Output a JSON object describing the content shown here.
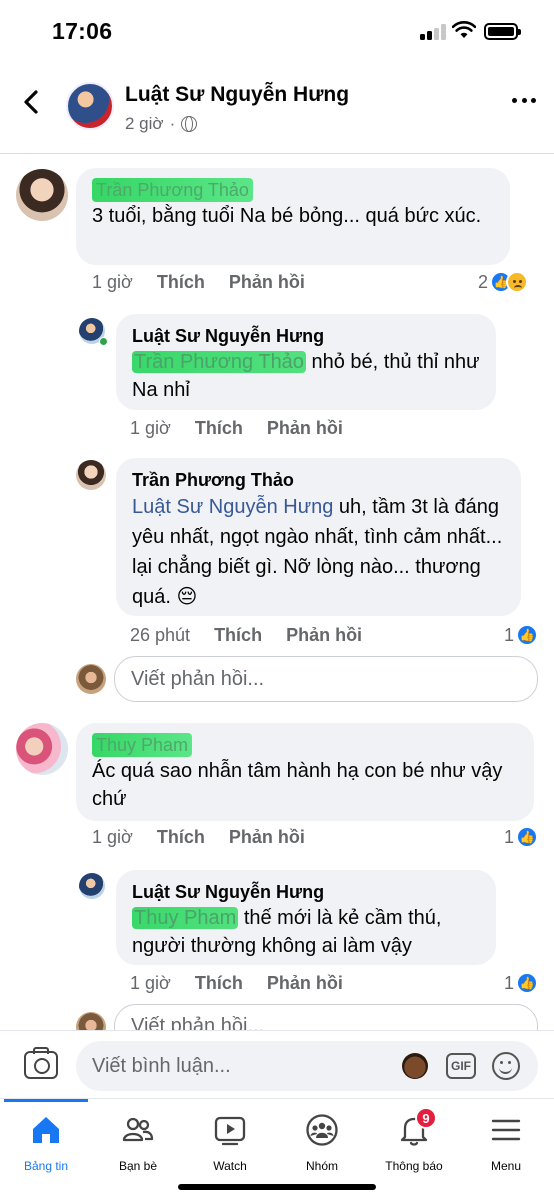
{
  "status_bar": {
    "time": "17:06"
  },
  "header": {
    "name": "Luật Sư Nguyễn Hưng",
    "time": "2 giờ",
    "separator": "·"
  },
  "comments": [
    {
      "author": "Trần Phương Thảo",
      "text": "3 tuổi, bằng tuổi Na bé bỏng... quá bức xúc.",
      "time": "1 giờ",
      "like": "Thích",
      "reply": "Phản hồi",
      "reaction_count": "2",
      "replies": [
        {
          "author": "Luật Sư Nguyễn Hưng",
          "mention": "Trần Phương Thảo",
          "text": " nhỏ bé, thủ thỉ như Na nhỉ",
          "time": "1 giờ",
          "like": "Thích",
          "reply": "Phản hồi"
        },
        {
          "author": "Trần Phương Thảo",
          "mention": "Luật Sư Nguyễn Hưng",
          "text": "  uh, tầm 3t là đáng yêu nhất, ngọt ngào nhất, tình cảm nhất... lại chẳng biết gì. Nỡ lòng nào... thương quá. 😔",
          "time": "26 phút",
          "like": "Thích",
          "reply": "Phản hồi",
          "reaction_count": "1"
        }
      ],
      "reply_placeholder": "Viết phản hồi..."
    },
    {
      "author": "Thuy Pham",
      "text": "Ác quá sao nhẫn tâm hành hạ con bé như vậy chứ",
      "time": "1 giờ",
      "like": "Thích",
      "reply": "Phản hồi",
      "reaction_count": "1",
      "replies": [
        {
          "author": "Luật Sư Nguyễn Hưng",
          "mention": "Thuy Pham",
          "text": " thế mới là kẻ cầm thú, người thường không ai làm vậy",
          "time": "1 giờ",
          "like": "Thích",
          "reply": "Phản hồi",
          "reaction_count": "1"
        }
      ],
      "reply_placeholder": "Viết phản hồi..."
    }
  ],
  "composer": {
    "placeholder": "Viết bình luận...",
    "gif_label": "GIF"
  },
  "tabs": [
    {
      "label": "Bảng tin",
      "icon": "home-icon",
      "active": true
    },
    {
      "label": "Bạn bè",
      "icon": "friends-icon"
    },
    {
      "label": "Watch",
      "icon": "watch-icon"
    },
    {
      "label": "Nhóm",
      "icon": "groups-icon"
    },
    {
      "label": "Thông báo",
      "icon": "bell-icon",
      "badge": "9"
    },
    {
      "label": "Menu",
      "icon": "menu-icon"
    }
  ],
  "colors": {
    "accent": "#1877f2",
    "bubble": "#f0f2f5",
    "secondary_text": "#65676b",
    "badge": "#e41e3f"
  }
}
